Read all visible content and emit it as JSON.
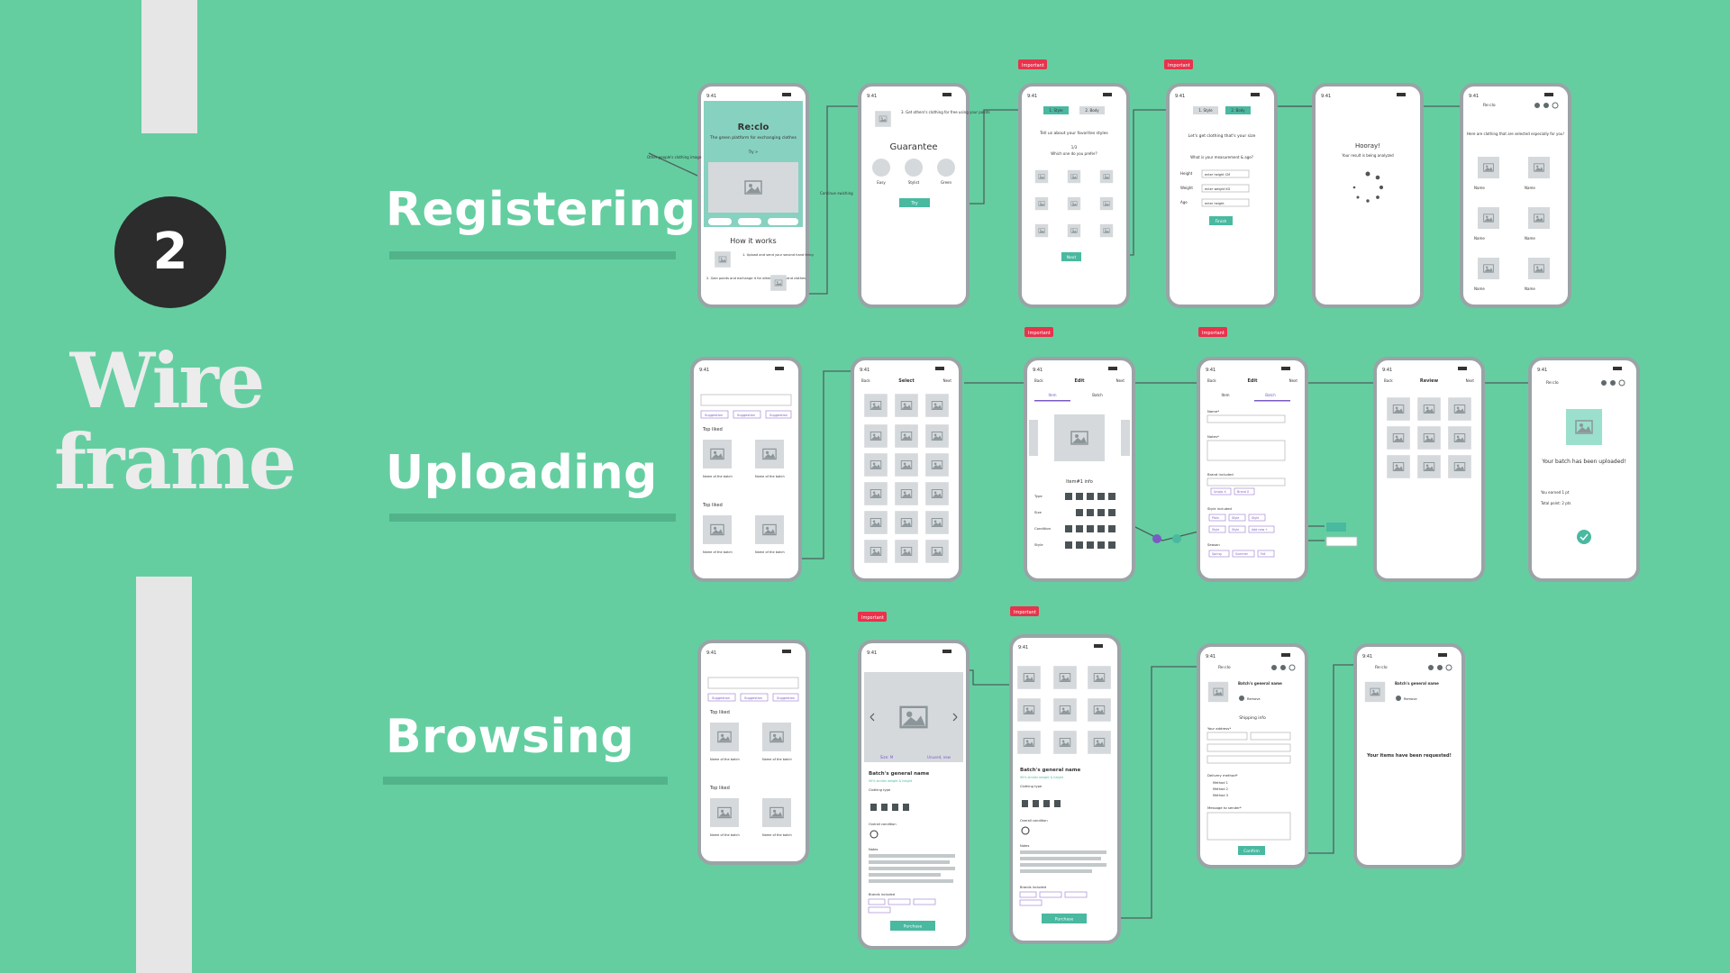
{
  "step_number": "2",
  "title_lines": [
    "Wire",
    "frame"
  ],
  "sections": {
    "registering": "Registering",
    "uploading": "Uploading",
    "browsing": "Browsing"
  },
  "colors": {
    "background": "#64cea1",
    "accent": "#49b9a0",
    "important_tag": "#e8334d"
  },
  "tag_label": "Important",
  "screens": {
    "reg1": {
      "brand": "Re:clo",
      "tagline": "The green platform for exchanging clothes",
      "cta": "Try >",
      "how": "How it works",
      "step1": "1. Upload and send your second hand thing",
      "step2": "2. Gain points and exchange it for other second hand clothes",
      "note": "Other people's clothing image"
    },
    "reg2": {
      "text": "3. Get others's clothing for free using your points",
      "title": "Guarantee",
      "opts": [
        "Easy",
        "Stylist",
        "Green"
      ],
      "btn": "Try",
      "note": "Continue swiching"
    },
    "reg3": {
      "tabs": [
        "1. Style",
        "2. Body"
      ],
      "title": "Tell us about your favorites styles",
      "counter": "1/3",
      "question": "Which one do you prefer?",
      "btn": "Next"
    },
    "reg4": {
      "tabs": [
        "1. Style",
        "2. Body"
      ],
      "title": "Let's get clothing that's your size",
      "question": "What is your measurement & age?",
      "fields": [
        "Height",
        "Weight",
        "Age"
      ],
      "placeholders": [
        "enter height CM",
        "enter weight KG",
        "enter height"
      ],
      "btn": "Finish"
    },
    "reg5": {
      "title": "Hooray!",
      "sub": "Your result is being analyzed"
    },
    "reg6": {
      "brand": "Re:clo",
      "text": "Here are clothing that are selected especially for you!",
      "name": "Name"
    },
    "up1": {
      "chips": [
        "Suggestion",
        "Suggestion",
        "Suggestion"
      ],
      "section": "Top liked",
      "item": "Name of the batch"
    },
    "up2": {
      "back": "Back",
      "title": "Select",
      "next": "Next"
    },
    "up3": {
      "back": "Back",
      "title": "Edit",
      "next": "Next",
      "tabs": [
        "Item",
        "Batch"
      ],
      "info": "Item#1 info",
      "rows": [
        "Type",
        "Size",
        "Condition",
        "Style"
      ]
    },
    "up4": {
      "back": "Back",
      "title": "Edit",
      "next": "Next",
      "tabs": [
        "Item",
        "Batch"
      ],
      "labels": [
        "Name*",
        "Notes*",
        "Brand included",
        "Style included",
        "Season"
      ],
      "brands": [
        "Uniqlo X",
        "Brand X"
      ],
      "styles": [
        "Plain",
        "Style",
        "Style",
        "Style",
        "Style"
      ],
      "add": "Add new +",
      "seasons": [
        "Spring",
        "Summer",
        "Fall"
      ]
    },
    "up5": {
      "back": "Back",
      "title": "Review",
      "next": "Next"
    },
    "up6": {
      "brand": "Re:clo",
      "title": "Your batch has been uploaded!",
      "earned": "You earned 1 pt",
      "total": "Total point: 2 pts"
    },
    "br2": {
      "size": "Size: M",
      "cond": "Unused, new",
      "name": "Batch's general name",
      "match": "90% similar weight & height",
      "clothing": "Clothing type",
      "overall": "Overall condition",
      "notes": "Notes",
      "brands": "Brands included",
      "btn": "Purchase"
    },
    "br4": {
      "brand": "Re:clo",
      "name": "Batch's general name",
      "remove": "Remove",
      "shipping": "Shipping info",
      "address": "Your address*",
      "delivery": "Delivery method*",
      "methods": [
        "Method 1",
        "Method 2",
        "Method 3"
      ],
      "message": "Message to sender*",
      "btn": "Confirm"
    },
    "br5": {
      "brand": "Re:clo",
      "name": "Batch's general name",
      "remove": "Remove",
      "title": "Your items have been requested!"
    }
  }
}
